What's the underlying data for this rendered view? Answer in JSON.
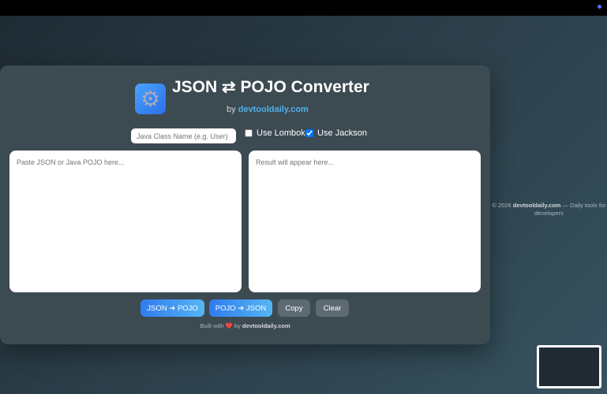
{
  "header": {
    "title": "JSON ⇄ POJO Converter",
    "by_prefix": "by",
    "by_link": "devtooldaily.com",
    "logo_icon": "gear-icon"
  },
  "options": {
    "class_name_placeholder": "Java Class Name (e.g. User)",
    "use_lombok_label": "Use Lombok",
    "use_lombok_checked": false,
    "use_jackson_label": "Use Jackson",
    "use_jackson_checked": true
  },
  "input": {
    "placeholder": "Paste JSON or Java POJO here..."
  },
  "output": {
    "placeholder": "Result will appear here..."
  },
  "buttons": {
    "json_to_pojo": "JSON ➜ POJO",
    "pojo_to_json": "POJO ➜ JSON",
    "copy": "Copy",
    "clear": "Clear"
  },
  "built": {
    "prefix": "Built with",
    "heart": "❤️",
    "by": "by",
    "link": "devtooldaily.com"
  },
  "footer": {
    "copyright": "© 2026",
    "link": "devtooldaily.com",
    "tagline": "— Daily tools for developers"
  }
}
